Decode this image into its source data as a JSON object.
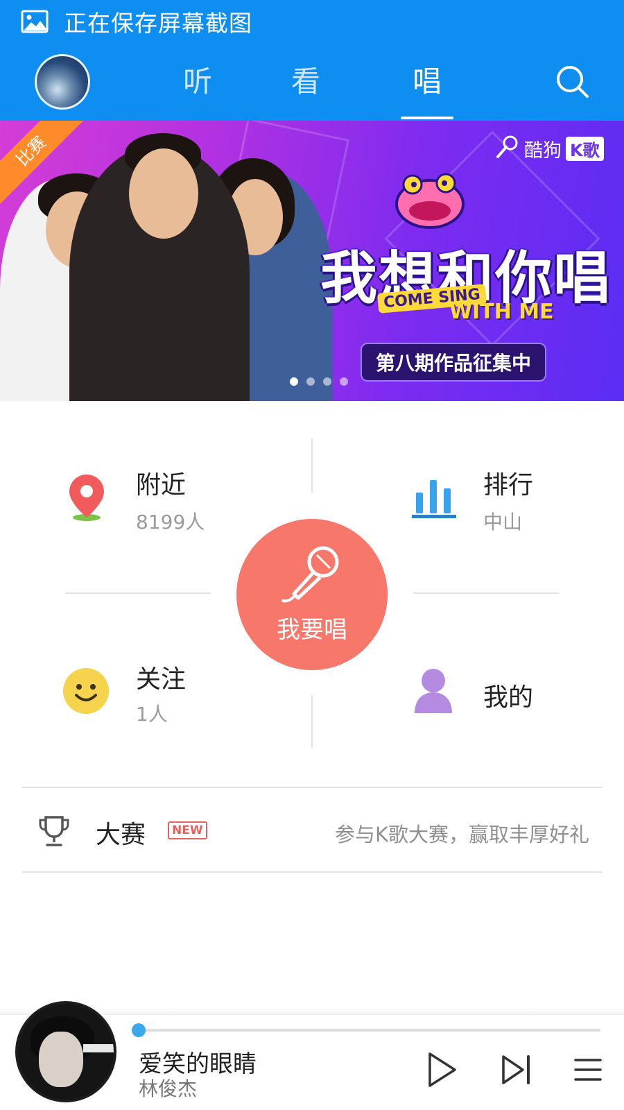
{
  "status_bar": {
    "text": "正在保存屏幕截图",
    "icon": "image-icon"
  },
  "header": {
    "tabs": [
      {
        "label": "听",
        "active": false
      },
      {
        "label": "看",
        "active": false
      },
      {
        "label": "唱",
        "active": true
      }
    ],
    "search_icon": "search-icon",
    "accent_color": "#0d8ef0"
  },
  "banner": {
    "corner_tag": "比赛",
    "brand_name": "酷狗",
    "brand_k": "K歌",
    "title": "我想和你唱",
    "subtitle_en_1": "COME SING",
    "subtitle_en_2": "WITH ME",
    "tagline": "第八期作品征集中",
    "dots_total": 4,
    "dots_active_index": 0
  },
  "quick": {
    "nearby": {
      "title": "附近",
      "sub": "8199人",
      "icon": "location-pin-icon"
    },
    "ranking": {
      "title": "排行",
      "sub": "中山",
      "icon": "bar-chart-icon"
    },
    "follow": {
      "title": "关注",
      "sub": "1人",
      "icon": "smiley-icon"
    },
    "mine": {
      "title": "我的",
      "icon": "person-icon"
    },
    "sing": {
      "label": "我要唱",
      "icon": "microphone-icon",
      "color": "#f7776a"
    }
  },
  "contest": {
    "title": "大赛",
    "badge": "NEW",
    "description": "参与K歌大赛，赢取丰厚好礼",
    "icon": "trophy-icon"
  },
  "player": {
    "song_title": "爱笑的眼睛",
    "artist": "林俊杰",
    "progress": 0.0,
    "controls": [
      "play-icon",
      "next-icon",
      "playlist-icon"
    ]
  }
}
